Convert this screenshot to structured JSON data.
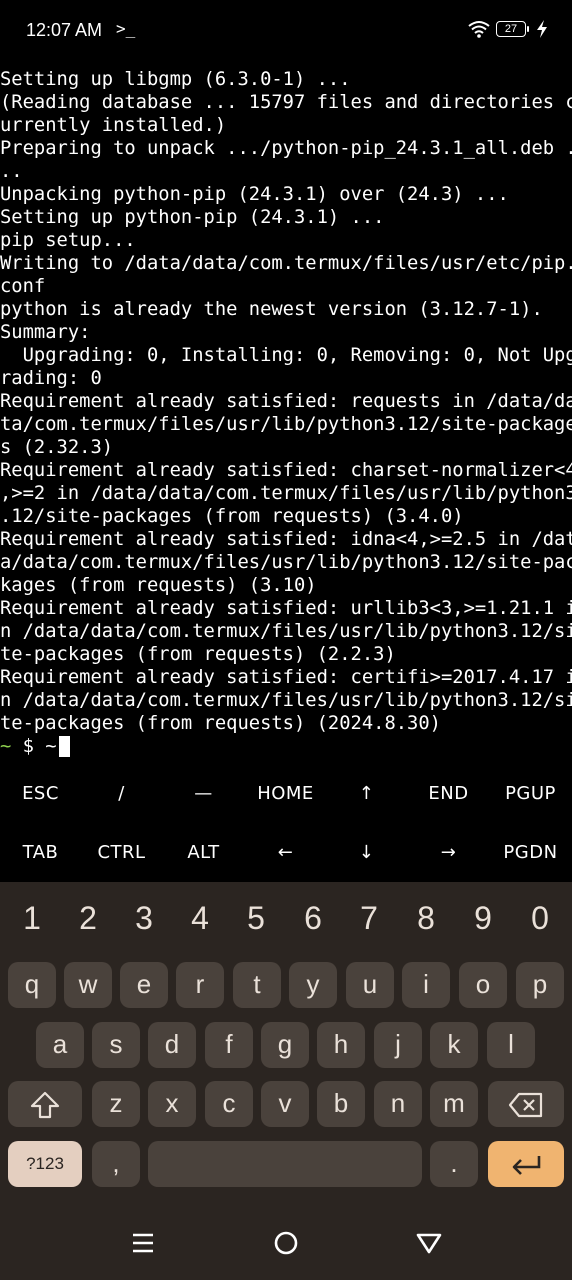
{
  "status_bar": {
    "time": "12:07 AM",
    "prompt_icon": ">_",
    "battery": "27",
    "icons": [
      "terminal-prompt-icon",
      "wifi-icon",
      "battery-icon",
      "charging-bolt-icon"
    ]
  },
  "terminal": {
    "lines": [
      "Setting up libgmp (6.3.0-1) ...",
      "(Reading database ... 15797 files and directories c",
      "urrently installed.)",
      "Preparing to unpack .../python-pip_24.3.1_all.deb .",
      "..",
      "Unpacking python-pip (24.3.1) over (24.3) ...",
      "Setting up python-pip (24.3.1) ...",
      "pip setup...",
      "Writing to /data/data/com.termux/files/usr/etc/pip.",
      "conf",
      "python is already the newest version (3.12.7-1).",
      "Summary:",
      "  Upgrading: 0, Installing: 0, Removing: 0, Not Upg",
      "rading: 0",
      "Requirement already satisfied: requests in /data/da",
      "ta/com.termux/files/usr/lib/python3.12/site-package",
      "s (2.32.3)",
      "Requirement already satisfied: charset-normalizer<4",
      ",>=2 in /data/data/com.termux/files/usr/lib/python3",
      ".12/site-packages (from requests) (3.4.0)",
      "Requirement already satisfied: idna<4,>=2.5 in /dat",
      "a/data/com.termux/files/usr/lib/python3.12/site-pac",
      "kages (from requests) (3.10)",
      "Requirement already satisfied: urllib3<3,>=1.21.1 i",
      "n /data/data/com.termux/files/usr/lib/python3.12/si",
      "te-packages (from requests) (2.2.3)",
      "Requirement already satisfied: certifi>=2017.4.17 i",
      "n /data/data/com.termux/files/usr/lib/python3.12/si",
      "te-packages (from requests) (2024.8.30)"
    ],
    "prompt": {
      "tilde": "~",
      "text": " $ ~"
    }
  },
  "extra_keys": {
    "row1": [
      "ESC",
      "/",
      "—",
      "HOME",
      "↑",
      "END",
      "PGUP"
    ],
    "row2": [
      "TAB",
      "CTRL",
      "ALT",
      "←",
      "↓",
      "→",
      "PGDN"
    ]
  },
  "keyboard": {
    "numbers": [
      "1",
      "2",
      "3",
      "4",
      "5",
      "6",
      "7",
      "8",
      "9",
      "0"
    ],
    "row1": [
      "q",
      "w",
      "e",
      "r",
      "t",
      "y",
      "u",
      "i",
      "o",
      "p"
    ],
    "row2": [
      "a",
      "s",
      "d",
      "f",
      "g",
      "h",
      "j",
      "k",
      "l"
    ],
    "row3": [
      "z",
      "x",
      "c",
      "v",
      "b",
      "n",
      "m"
    ],
    "symbols_label": "?123",
    "comma": ",",
    "period": ".",
    "colors": {
      "background": "#2b2521",
      "key": "#4a423c",
      "symbols_key": "#e4cfc0",
      "enter_key": "#f0b470"
    }
  },
  "nav_bar": {
    "icons": [
      "menu-icon",
      "home-circle-icon",
      "back-triangle-icon"
    ]
  }
}
